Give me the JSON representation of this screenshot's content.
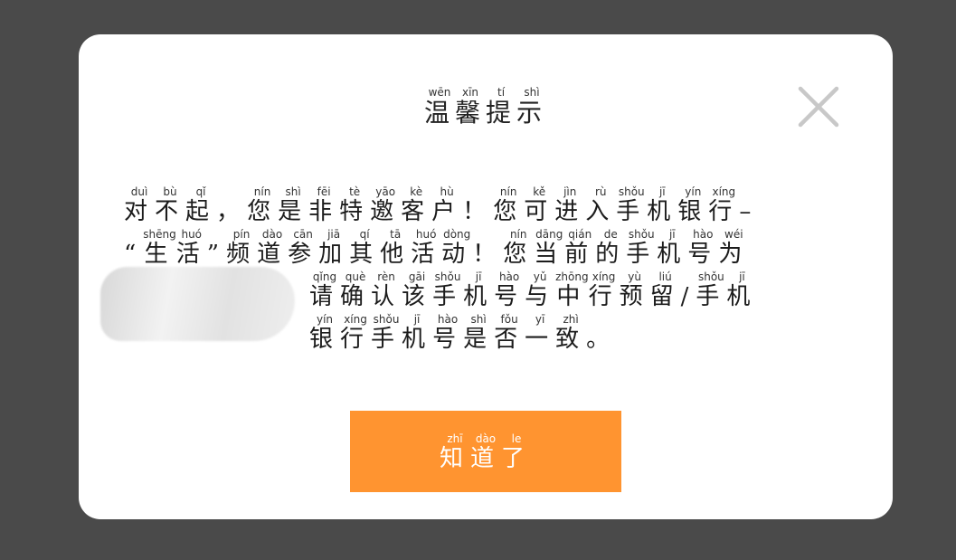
{
  "dialog": {
    "title": [
      {
        "c": "温",
        "p": "wēn"
      },
      {
        "c": "馨",
        "p": "xīn"
      },
      {
        "c": "提",
        "p": "tí"
      },
      {
        "c": "示",
        "p": "shì"
      }
    ],
    "close_icon": "close-icon",
    "lines": [
      [
        {
          "c": "对",
          "p": "duì"
        },
        {
          "c": "不",
          "p": "bù"
        },
        {
          "c": "起",
          "p": "qǐ"
        },
        {
          "c": "，",
          "p": ""
        },
        {
          "c": "您",
          "p": "nín"
        },
        {
          "c": "是",
          "p": "shì"
        },
        {
          "c": "非",
          "p": "fēi"
        },
        {
          "c": "特",
          "p": "tè"
        },
        {
          "c": "邀",
          "p": "yāo"
        },
        {
          "c": "客",
          "p": "kè"
        },
        {
          "c": "户",
          "p": "hù"
        },
        {
          "c": "！",
          "p": ""
        },
        {
          "c": "您",
          "p": "nín"
        },
        {
          "c": "可",
          "p": "kě"
        },
        {
          "c": "进",
          "p": "jìn"
        },
        {
          "c": "入",
          "p": "rù"
        },
        {
          "c": "手",
          "p": "shǒu"
        },
        {
          "c": "机",
          "p": "jī"
        },
        {
          "c": "银",
          "p": "yín"
        },
        {
          "c": "行",
          "p": "xíng"
        },
        {
          "c": "–",
          "p": ""
        }
      ],
      [
        {
          "c": "“",
          "p": ""
        },
        {
          "c": "生",
          "p": "shēng"
        },
        {
          "c": "活",
          "p": "huó"
        },
        {
          "c": "”",
          "p": ""
        },
        {
          "c": "频",
          "p": "pín"
        },
        {
          "c": "道",
          "p": "dào"
        },
        {
          "c": "参",
          "p": "cān"
        },
        {
          "c": "加",
          "p": "jiā"
        },
        {
          "c": "其",
          "p": "qí"
        },
        {
          "c": "他",
          "p": "tā"
        },
        {
          "c": "活",
          "p": "huó"
        },
        {
          "c": "动",
          "p": "dòng"
        },
        {
          "c": "！",
          "p": ""
        },
        {
          "c": "您",
          "p": "nín"
        },
        {
          "c": "当",
          "p": "dāng"
        },
        {
          "c": "前",
          "p": "qián"
        },
        {
          "c": "的",
          "p": "de"
        },
        {
          "c": "手",
          "p": "shǒu"
        },
        {
          "c": "机",
          "p": "jī"
        },
        {
          "c": "号",
          "p": "hào"
        },
        {
          "c": "为",
          "p": "wéi"
        }
      ],
      [
        {
          "c": "请",
          "p": "qǐng"
        },
        {
          "c": "确",
          "p": "què"
        },
        {
          "c": "认",
          "p": "rèn"
        },
        {
          "c": "该",
          "p": "gāi"
        },
        {
          "c": "手",
          "p": "shǒu"
        },
        {
          "c": "机",
          "p": "jī"
        },
        {
          "c": "号",
          "p": "hào"
        },
        {
          "c": "与",
          "p": "yǔ"
        },
        {
          "c": "中",
          "p": "zhōng"
        },
        {
          "c": "行",
          "p": "xíng"
        },
        {
          "c": "预",
          "p": "yù"
        },
        {
          "c": "留",
          "p": "liú"
        },
        {
          "c": "/",
          "p": ""
        },
        {
          "c": "手",
          "p": "shǒu"
        },
        {
          "c": "机",
          "p": "jī"
        }
      ],
      [
        {
          "c": "银",
          "p": "yín"
        },
        {
          "c": "行",
          "p": "xíng"
        },
        {
          "c": "手",
          "p": "shǒu"
        },
        {
          "c": "机",
          "p": "jī"
        },
        {
          "c": "号",
          "p": "hào"
        },
        {
          "c": "是",
          "p": "shì"
        },
        {
          "c": "否",
          "p": "fǒu"
        },
        {
          "c": "一",
          "p": "yī"
        },
        {
          "c": "致",
          "p": "zhì"
        },
        {
          "c": "。",
          "p": ""
        }
      ]
    ],
    "ok_button": [
      {
        "c": "知",
        "p": "zhī"
      },
      {
        "c": "道",
        "p": "dào"
      },
      {
        "c": "了",
        "p": "le"
      }
    ],
    "colors": {
      "overlay": "#4a4a4a",
      "dialog_bg": "#ffffff",
      "button_bg": "#ff9430",
      "button_text": "#ffffff",
      "close_icon": "#c8c8c8"
    }
  }
}
